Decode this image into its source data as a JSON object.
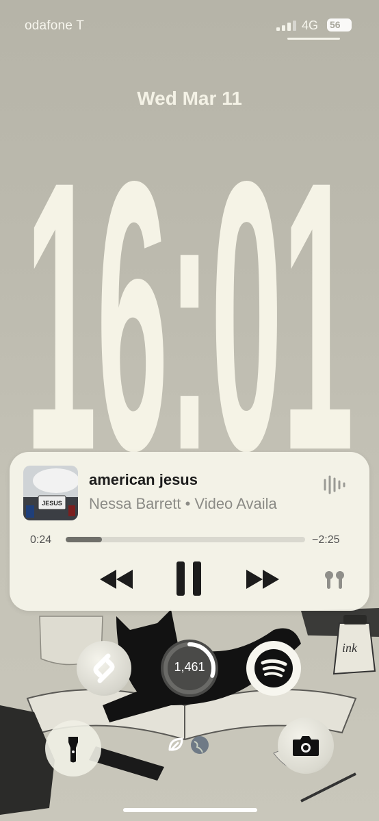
{
  "status_bar": {
    "carrier": "odafone T",
    "network": "4G",
    "battery": "56"
  },
  "lock": {
    "date": "Wed Mar 11",
    "time": "16:01"
  },
  "now_playing": {
    "title": "american jesus",
    "artist_line": "Nessa Barrett • Video Availa",
    "artwork_text": "JESUS",
    "elapsed": "0:24",
    "remaining": "−2:25",
    "progress_fraction": 0.15
  },
  "widgets": {
    "steps": "1,461",
    "steps_ring_fraction": 0.3
  },
  "colors": {
    "clock": "#f7f5e8",
    "widget_bg": "#f6f5eb",
    "accent_dark": "#1c1c1c"
  },
  "icons": [
    "signal-icon",
    "battery-icon",
    "waveform-icon",
    "rewind-icon",
    "pause-icon",
    "forward-icon",
    "airpods-icon",
    "shazam-icon",
    "spotify-icon",
    "flashlight-icon",
    "camera-icon",
    "leaf-icon",
    "earth-icon"
  ]
}
